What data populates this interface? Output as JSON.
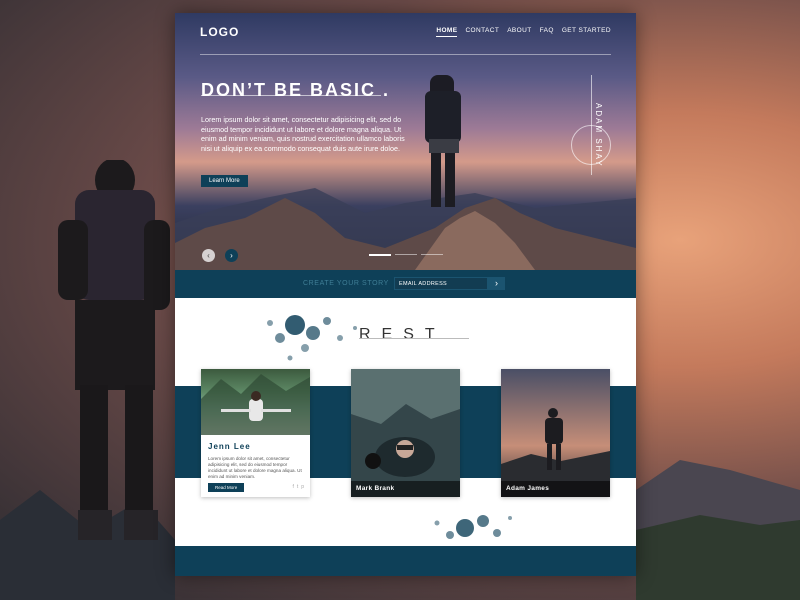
{
  "nav": {
    "logo": "LOGO",
    "items": [
      {
        "label": "HOME",
        "active": true
      },
      {
        "label": "CONTACT"
      },
      {
        "label": "ABOUT"
      },
      {
        "label": "FAQ"
      },
      {
        "label": "GET STARTED"
      }
    ]
  },
  "hero": {
    "title": "DON’T BE BASIC .",
    "body": "Lorem ipsum dolor sit amet, consectetur adipisicing elit, sed do eiusmod tempor incididunt ut labore et dolore magna aliqua. Ut enim ad minim veniam, quis nostrud exercitation ullamco laboris nisi ut aliquip ex ea commodo consequat duis aute irure doloe.",
    "button": "Learn More",
    "side_name": "ADAM SHAY",
    "prev_icon": "‹",
    "next_icon": "›"
  },
  "story": {
    "label": "CREATE YOUR STORY",
    "email_placeholder": "EMAIL ADDRESS",
    "submit_icon": "›"
  },
  "section": {
    "title": "REST"
  },
  "cards": [
    {
      "name": "Jenn Lee",
      "text": "Lorem ipsum dolor sit amet, consectetur adipisicing elit, sed do eiusmod tempor incididunt ut labore et dolore magna aliqua. Ut enim ad minim veniam.",
      "button": "Read More",
      "socials": [
        "f",
        "t",
        "p"
      ]
    },
    {
      "name": "Mark Brank"
    },
    {
      "name": "Adam James"
    }
  ],
  "colors": {
    "accent": "#0e4058",
    "text_light": "#ffffff"
  }
}
